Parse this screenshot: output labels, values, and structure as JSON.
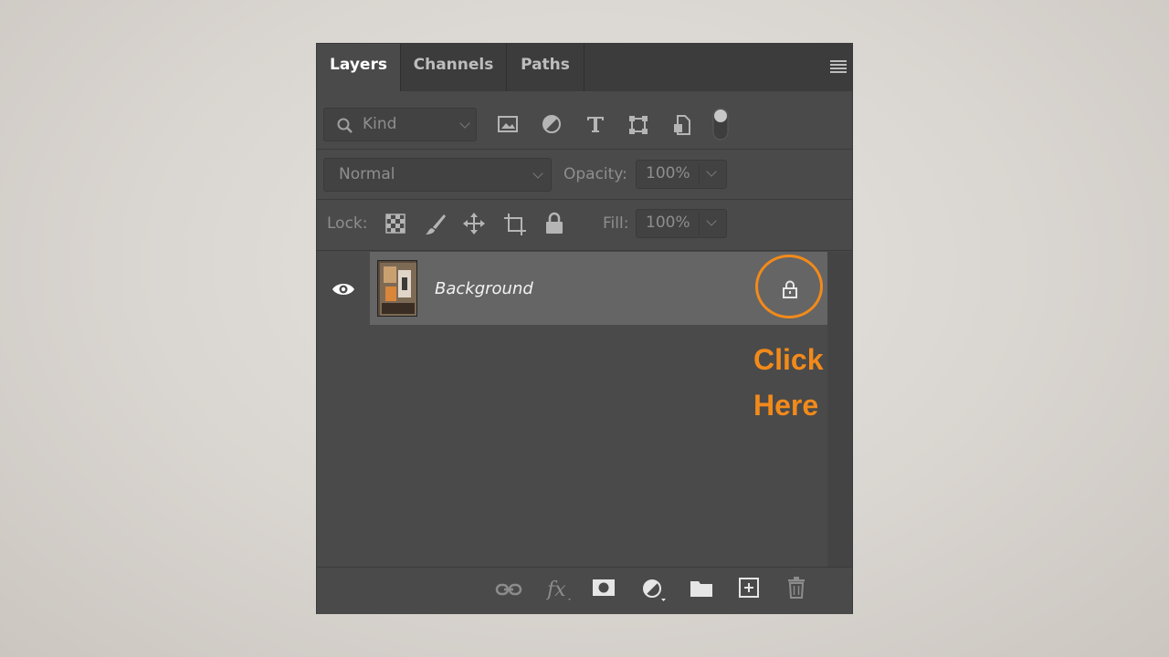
{
  "tabs": [
    {
      "label": "Layers",
      "active": true
    },
    {
      "label": "Channels",
      "active": false
    },
    {
      "label": "Paths",
      "active": false
    }
  ],
  "filter": {
    "kind_label": "Kind",
    "icons": [
      "image-filter-icon",
      "adjustment-filter-icon",
      "type-filter-icon",
      "shape-filter-icon",
      "smart-object-filter-icon",
      "filter-toggle-icon"
    ]
  },
  "blend": {
    "mode": "Normal",
    "opacity_label": "Opacity:",
    "opacity_value": "100%"
  },
  "lock": {
    "label": "Lock:",
    "icons": [
      "lock-transparent-pixels-icon",
      "lock-image-pixels-icon",
      "lock-position-icon",
      "lock-artboard-icon",
      "lock-all-icon"
    ],
    "fill_label": "Fill:",
    "fill_value": "100%"
  },
  "layers": [
    {
      "name": "Background",
      "visible": true,
      "locked": true
    }
  ],
  "annotation": {
    "line1": "Click",
    "line2": "Here",
    "color": "#f28a1a"
  },
  "bottom_icons": [
    "link-layers-icon",
    "fx-icon",
    "add-mask-icon",
    "adjustment-layer-icon",
    "new-group-icon",
    "new-layer-icon",
    "delete-layer-icon"
  ],
  "colors": {
    "panel_bg": "#4a4a4a",
    "tab_bar_bg": "#3c3c3c",
    "selected_layer_bg": "#656565",
    "accent_orange": "#f28a1a"
  }
}
